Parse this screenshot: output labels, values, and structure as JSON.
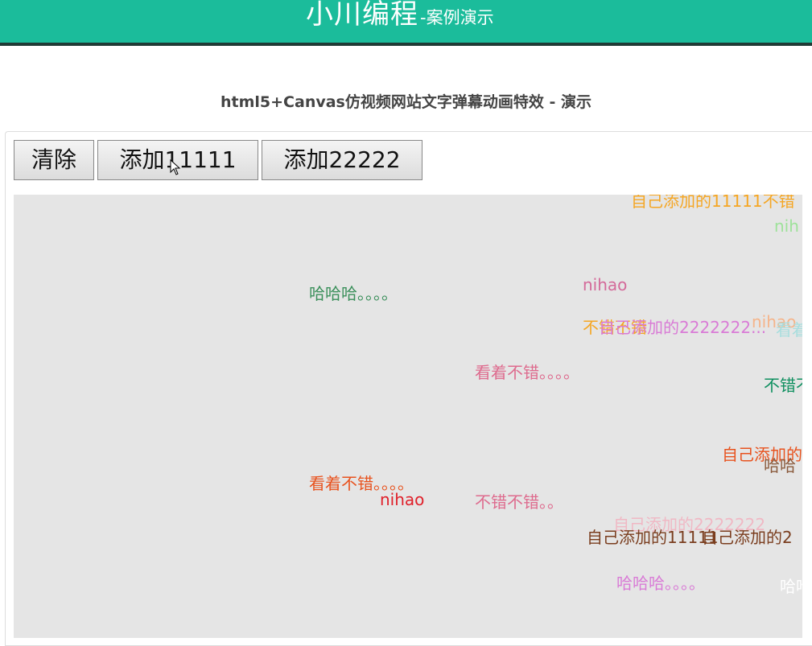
{
  "header": {
    "brand_main": "小川编程",
    "brand_sub": "-案例演示"
  },
  "page": {
    "title": "html5+Canvas仿视频网站文字弹幕动画特效 - 演示"
  },
  "toolbar": {
    "clear_label": "清除",
    "add1_label": "添加11111",
    "add2_label": "添加22222"
  },
  "danmaku": {
    "items": [
      {
        "text": "自己添加的11111不错",
        "color": "#f5a623"
      },
      {
        "text": "nih",
        "color": "#9ee29a"
      },
      {
        "text": "nihao",
        "color": "#d46a9a"
      },
      {
        "text": "哈哈哈。。。。",
        "color": "#3a8f5a"
      },
      {
        "text": "不错不错",
        "color": "#f5a623"
      },
      {
        "text": "自己添加的2222222...",
        "color": "#d97bd6"
      },
      {
        "text": "nihao",
        "color": "#f5b48a"
      },
      {
        "text": "看着",
        "color": "#a8dede"
      },
      {
        "text": "看着不错。。。。",
        "color": "#de6b8e"
      },
      {
        "text": "不错不",
        "color": "#0f8f5f"
      },
      {
        "text": "自己添加的",
        "color": "#e8531f"
      },
      {
        "text": "哈哈",
        "color": "#8a5a3c"
      },
      {
        "text": "看着不错。。。。",
        "color": "#e8531f"
      },
      {
        "text": "nihao",
        "color": "#e0202a"
      },
      {
        "text": "不错不错。。",
        "color": "#de6b8e"
      },
      {
        "text": "自己添加的2222222",
        "color": "#f0b8c4"
      },
      {
        "text": "自己添加的11111",
        "color": "#7a3d1e"
      },
      {
        "text": "自己添加的2",
        "color": "#7a3d1e"
      },
      {
        "text": "哈哈哈。。。。",
        "color": "#d97bd6"
      },
      {
        "text": "哈哈",
        "color": "#ffffff"
      }
    ]
  }
}
